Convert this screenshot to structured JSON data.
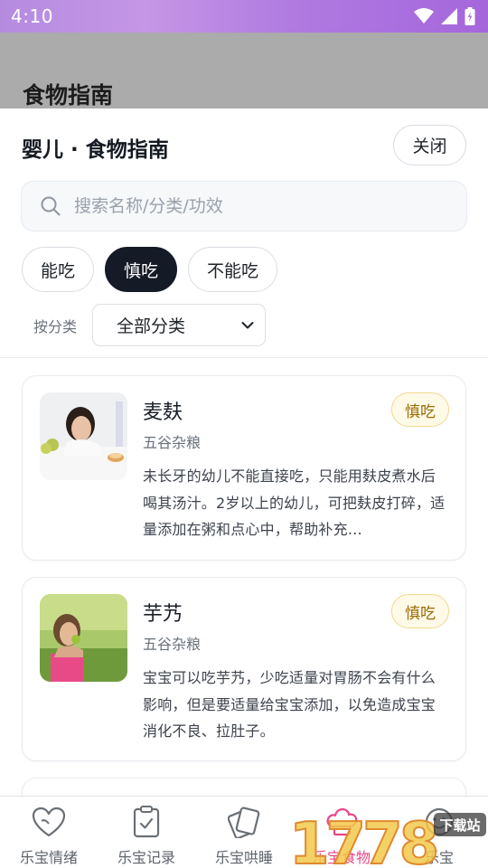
{
  "status_bar": {
    "time": "4:10"
  },
  "backdrop": {
    "title": "食物指南"
  },
  "sheet": {
    "title": "婴儿 · 食物指南",
    "close_label": "关闭",
    "search": {
      "placeholder": "搜索名称/分类/功效",
      "value": ""
    },
    "chips": [
      {
        "label": "能吃",
        "active": false
      },
      {
        "label": "慎吃",
        "active": true
      },
      {
        "label": "不能吃",
        "active": false
      }
    ],
    "filter": {
      "label": "按分类",
      "selected": "全部分类"
    },
    "items": [
      {
        "name": "麦麸",
        "category": "五谷杂粮",
        "badge": "慎吃",
        "description": "未长牙的幼儿不能直接吃，只能用麸皮煮水后喝其汤汁。2岁以上的幼儿，可把麸皮打碎，适量添加在粥和点心中，帮助补充…"
      },
      {
        "name": "芋艿",
        "category": "五谷杂粮",
        "badge": "慎吃",
        "description": "宝宝可以吃芋艿，少吃适量对胃肠不会有什么影响，但是要适量给宝宝添加，以免造成宝宝消化不良、拉肚子。"
      }
    ]
  },
  "bottom_nav": [
    {
      "label": "乐宝情绪",
      "icon": "heart-icon",
      "active": false
    },
    {
      "label": "乐宝记录",
      "icon": "clipboard-check-icon",
      "active": false
    },
    {
      "label": "乐宝哄睡",
      "icon": "cards-icon",
      "active": false
    },
    {
      "label": "乐宝食物",
      "icon": "chef-hat-icon",
      "active": true
    },
    {
      "label": "乐宝",
      "icon": "face-icon",
      "active": false
    }
  ],
  "watermark": {
    "text": "1778",
    "subtext": "下载站"
  },
  "colors": {
    "accent": "#e8468a",
    "chip_active": "#141a26",
    "badge_bg": "#fffae8",
    "badge_text": "#9a6a00"
  }
}
